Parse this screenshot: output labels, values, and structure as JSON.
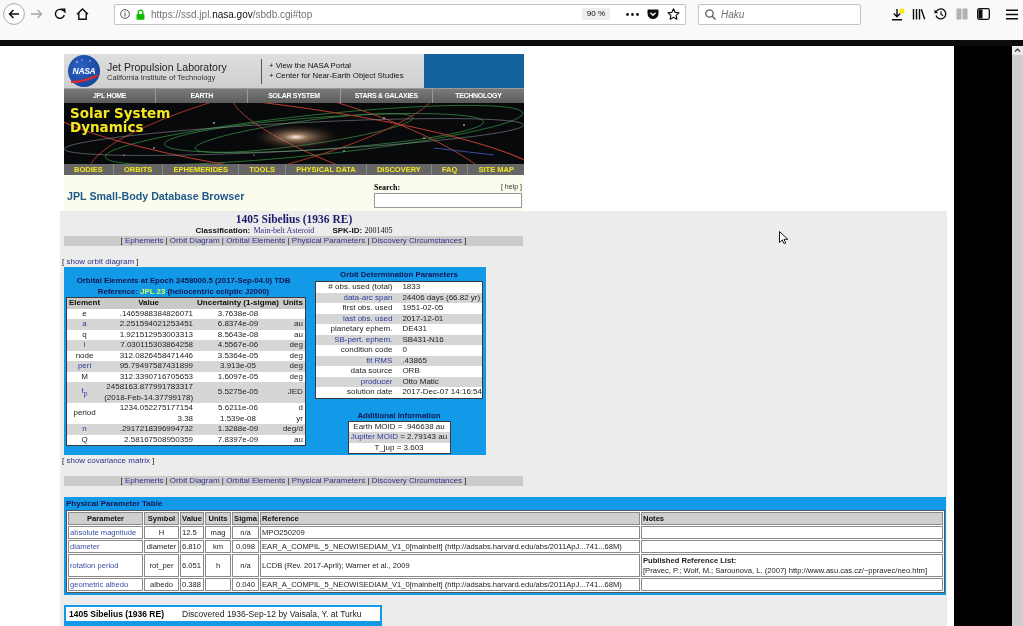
{
  "browser": {
    "url": "https://ssd.jpl.**nasa.gov**/sbdb.cgi#top",
    "zoom": "90 %",
    "search_placeholder": "Haku"
  },
  "header": {
    "logo_text": "NASA",
    "lab_name": "Jet Propulsion Laboratory",
    "institute": "California Institute of Technology",
    "portal_links": [
      "+ View the NASA Portal",
      "+ Center for Near-Earth Object Studies"
    ],
    "top_nav": [
      "JPL HOME",
      "EARTH",
      "SOLAR SYSTEM",
      "STARS & GALAXIES",
      "TECHNOLOGY"
    ],
    "banner_title": "Solar System Dynamics",
    "section_nav": [
      "BODIES",
      "ORBITS",
      "EPHEMERIDES",
      "TOOLS",
      "PHYSICAL DATA",
      "DISCOVERY",
      "FAQ",
      "SITE MAP"
    ],
    "page_title": "JPL Small-Body Database Browser",
    "search": {
      "label": "Search:",
      "help": "[ help ]"
    }
  },
  "object": {
    "title": "1405 Sibelius (1936 RE)",
    "classification_label": "Classification:",
    "classification": "Main-belt Asteroid",
    "spk_label": "SPK-ID:",
    "spk_id": "2001405"
  },
  "links_bar_top": [
    {
      "kind": "text",
      "text": "["
    },
    {
      "kind": "link",
      "text": "Ephemeris"
    },
    {
      "kind": "text",
      "text": "|"
    },
    {
      "kind": "link",
      "text": "Orbit Diagram"
    },
    {
      "kind": "text",
      "text": "|"
    },
    {
      "kind": "link",
      "text": "Orbital Elements"
    },
    {
      "kind": "text",
      "text": "|"
    },
    {
      "kind": "link",
      "text": "Physical Parameters"
    },
    {
      "kind": "text",
      "text": "|"
    },
    {
      "kind": "link",
      "text": "Discovery Circumstances"
    },
    {
      "kind": "text",
      "text": "]"
    }
  ],
  "orbit_diagram_toggle": [
    {
      "kind": "text",
      "text": "["
    },
    {
      "kind": "link",
      "text": "show orbit diagram"
    },
    {
      "kind": "text",
      "text": "]"
    }
  ],
  "orbital_elements": {
    "title": "Orbital Elements at Epoch 2458000.5 (2017-Sep-04.0) TDB",
    "reference": {
      "label": "Reference:",
      "link": "JPL 23",
      "note": "(heliocentric ecliptic J2000)"
    },
    "columns": [
      "Element",
      "Value",
      "Uncertainty (1-sigma)",
      "Units"
    ],
    "rows": [
      {
        "element": "e",
        "value": ".1465988384826071",
        "uncertainty": "3.7638e-08"
      },
      {
        "element": "a",
        "value": "2.251594021253451",
        "uncertainty": "6.8374e-09",
        "units": "au"
      },
      {
        "element": "q",
        "value": "1.921512953003313",
        "uncertainty": "8.5643e-08",
        "units": "au"
      },
      {
        "element": "i",
        "value": "7.030115303864258",
        "uncertainty": "4.5567e-06",
        "units": "deg"
      },
      {
        "element": "node",
        "value": "312.0826458471446",
        "uncertainty": "3.5364e-05",
        "units": "deg"
      },
      {
        "element": "peri",
        "value": "95.79497587431899",
        "uncertainty": "3.913e-05",
        "units": "deg"
      },
      {
        "element": "M",
        "value": "312.3390716705653",
        "uncertainty": "1.6097e-05",
        "units": "deg"
      },
      {
        "element": "t$_{p}$",
        "value": "2458163.877991783317",
        "value_note": "(2018-Feb-14.37799178)",
        "uncertainty": "5.5275e-05",
        "units": "JED"
      },
      {
        "element": "period",
        "value": "1234.052275177154",
        "uncertainty": "5.6211e-06",
        "units": "d",
        "extra": {
          "value": "3.38",
          "uncertainty": "1.539e-08",
          "units": "yr"
        }
      },
      {
        "element": "n",
        "value": ".2917218396994732",
        "uncertainty": "1.3288e-09",
        "units": "deg/d"
      },
      {
        "element": "Q",
        "value": "2.58167508950359",
        "uncertainty": "7.8397e-09",
        "units": "au"
      }
    ]
  },
  "orbit_determination": {
    "title": "Orbit Determination Parameters",
    "rows": [
      {
        "label": "# obs. used (total)",
        "value": "1833"
      },
      {
        "label": "data-arc span",
        "value": "24406 days (66.82 yr)"
      },
      {
        "label": "first obs. used",
        "value": "1951-02-05"
      },
      {
        "label": "last obs. used",
        "value": "2017-12-01"
      },
      {
        "label": "planetary ephem.",
        "value": "DE431"
      },
      {
        "label": "SB-pert. ephem.",
        "value": "SB431-N16"
      },
      {
        "label": "condition code",
        "value": "0"
      },
      {
        "label": "fit RMS",
        "value": ".43865"
      },
      {
        "label": "data source",
        "value": "ORB"
      },
      {
        "label": "producer",
        "value": "Otto Matic"
      },
      {
        "label": "solution date",
        "value": "2017-Dec-07 14:16:54"
      }
    ]
  },
  "additional_info": {
    "title": "Additional Information",
    "rows": [
      {
        "label": "Earth MOID",
        "value": "= .946638 au"
      },
      {
        "label": "Jupiter MOID",
        "value": "= 2.79143 au"
      },
      {
        "label": "T_jup",
        "value": "= 3.603"
      }
    ]
  },
  "covariance_toggle": [
    {
      "kind": "text",
      "text": "["
    },
    {
      "kind": "link",
      "text": "show covariance matrix"
    },
    {
      "kind": "text",
      "text": "]"
    }
  ],
  "links_bar_bottom": [
    {
      "kind": "text",
      "text": "["
    },
    {
      "kind": "link",
      "text": "Ephemeris"
    },
    {
      "kind": "text",
      "text": "|"
    },
    {
      "kind": "link",
      "text": "Orbit Diagram"
    },
    {
      "kind": "text",
      "text": "|"
    },
    {
      "kind": "link",
      "text": "Orbital Elements"
    },
    {
      "kind": "text",
      "text": "|"
    },
    {
      "kind": "link",
      "text": "Physical Parameters"
    },
    {
      "kind": "text",
      "text": "|"
    },
    {
      "kind": "link",
      "text": "Discovery Circumstances"
    },
    {
      "kind": "text",
      "text": "]"
    }
  ],
  "physical_parameters": {
    "title": "Physical Parameter Table",
    "columns": [
      "Parameter",
      "Symbol",
      "Value",
      "Units",
      "Sigma",
      "Reference",
      "Notes"
    ],
    "rows": [
      {
        "parameter": "absolute magnitude",
        "symbol": "H",
        "value": "12.5",
        "units": "mag",
        "sigma": "n/a",
        "reference": "MPO250209"
      },
      {
        "parameter": "diameter",
        "symbol": "diameter",
        "value": "6.810",
        "units": "km",
        "sigma": "0.098",
        "reference": "EAR_A_COMPIL_5_NEOWISEDIAM_V1_0[mainbelt] (http://adsabs.harvard.edu/abs/2011ApJ...741...68M)"
      },
      {
        "parameter": "rotation period",
        "symbol": "rot_per",
        "value": "6.051",
        "units": "h",
        "sigma": "n/a",
        "reference": "LCDB (Rev. 2017-April); Warner et al., 2009",
        "notes_title": "Published Reference List:",
        "notes": "[Pravec, P.; Wolf, M.; Sarounova, L. (2007) http://www.asu.cas.cz/~ppravec/neo.htm]"
      },
      {
        "parameter": "geometric albedo",
        "symbol": "albedo",
        "value": "0.388",
        "sigma": "0.040",
        "reference": "EAR_A_COMPIL_5_NEOWISEDIAM_V1_0[mainbelt] (http://adsabs.harvard.edu/abs/2011ApJ...741...68M)"
      }
    ]
  },
  "discovery": {
    "designation": "1405 Sibelius (1936 RE)",
    "text": "Discovered 1936-Sep-12 by Vaisala, Y. at Turku"
  }
}
